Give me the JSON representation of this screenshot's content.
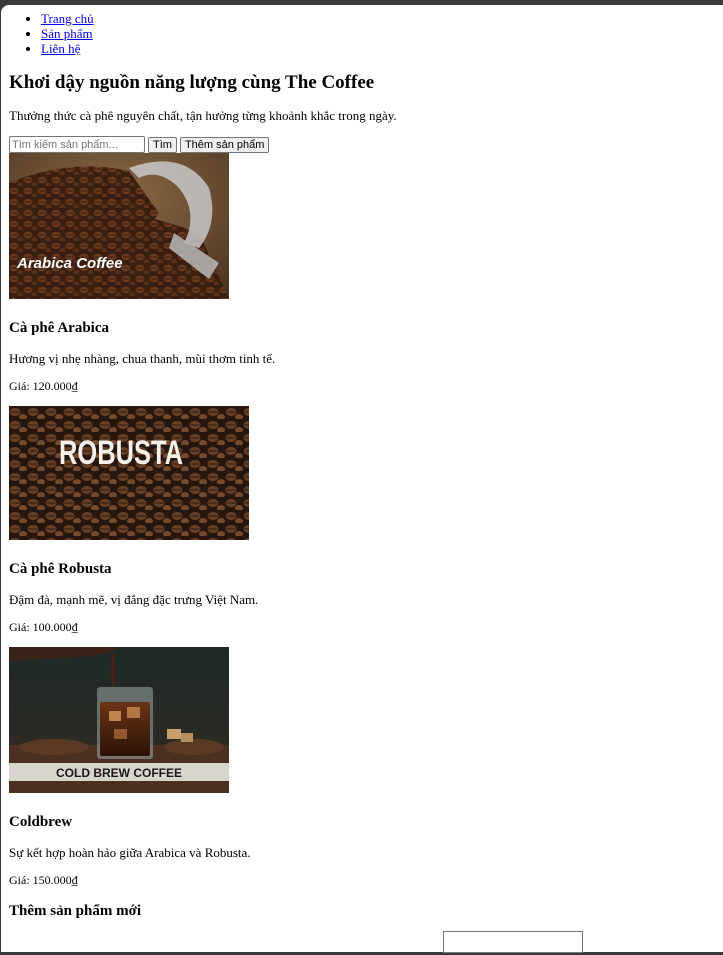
{
  "nav": [
    "Trang chủ",
    "Sản phẩm",
    "Liên hệ"
  ],
  "hero": {
    "title": "Khơi dậy nguồn năng lượng cùng The Coffee",
    "tagline": "Thưởng thức cà phê nguyên chất, tận hưởng từng khoảnh khắc trong ngày."
  },
  "search": {
    "placeholder": "Tìm kiếm sản phẩm...",
    "search_label": "Tìm",
    "add_label": "Thêm sản phẩm"
  },
  "products": [
    {
      "image_text": "Arabica Coffee",
      "name": "Cà phê Arabica",
      "desc": "Hương vị nhẹ nhàng, chua thanh, mùi thơm tinh tế.",
      "price": "Giá: 120.000₫"
    },
    {
      "image_text": "ROBUSTA",
      "name": "Cà phê Robusta",
      "desc": "Đậm đà, mạnh mẽ, vị đắng đặc trưng Việt Nam.",
      "price": "Giá: 100.000₫"
    },
    {
      "image_text": "COLD BREW COFFEE",
      "name": "Coldbrew",
      "desc": "Sự kết hợp hoàn hảo giữa Arabica và Robusta.",
      "price": "Giá: 150.000₫"
    }
  ],
  "add_form": {
    "title": "Thêm sản phẩm mới"
  }
}
